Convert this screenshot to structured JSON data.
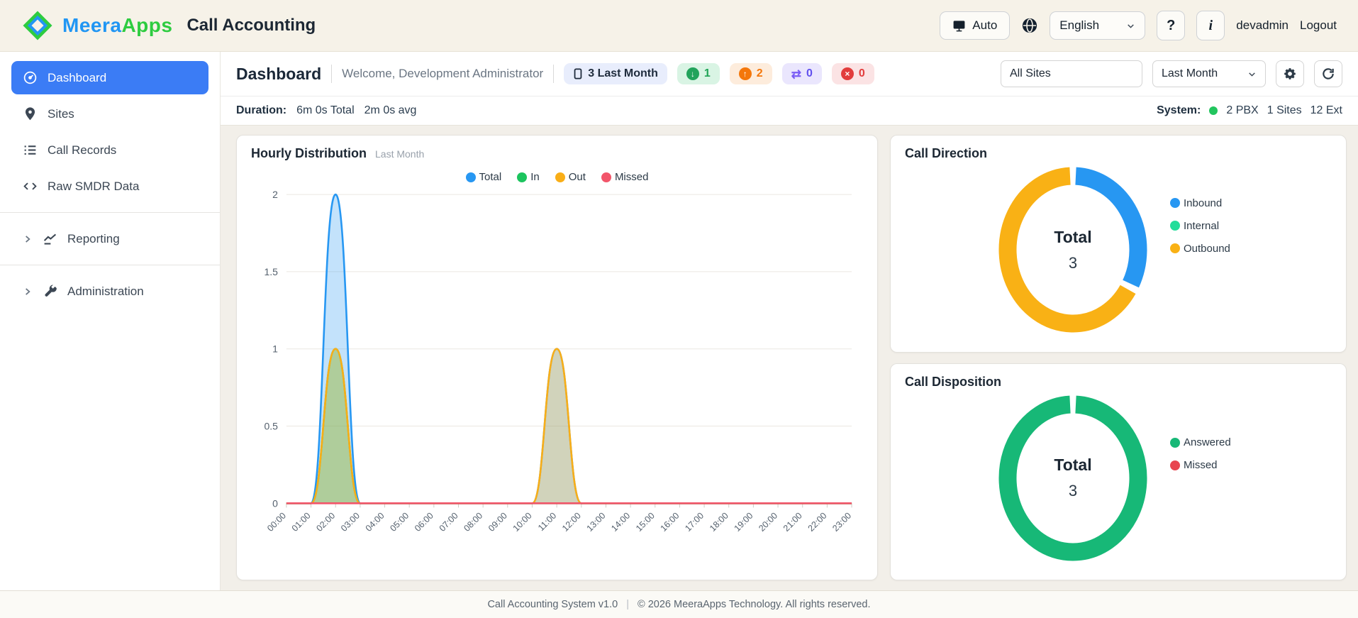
{
  "header": {
    "brand_meera": "Meera",
    "brand_apps": "Apps",
    "app_title": "Call Accounting",
    "auto_label": "Auto",
    "language": "English",
    "help_label": "?",
    "info_label": "i",
    "username": "devadmin",
    "logout_label": "Logout"
  },
  "sidebar": {
    "items": [
      {
        "label": "Dashboard",
        "icon": "speedometer-icon",
        "active": true
      },
      {
        "label": "Sites",
        "icon": "location-pin-icon",
        "active": false
      },
      {
        "label": "Call Records",
        "icon": "list-icon",
        "active": false
      },
      {
        "label": "Raw SMDR Data",
        "icon": "code-icon",
        "active": false
      },
      {
        "label": "Reporting",
        "icon": "trend-chart-icon",
        "active": false,
        "expandable": true
      },
      {
        "label": "Administration",
        "icon": "wrench-icon",
        "active": false,
        "expandable": true
      }
    ]
  },
  "page_header": {
    "title": "Dashboard",
    "welcome": "Welcome, Development Administrator",
    "period_badge": "3 Last Month",
    "inbound_count": "1",
    "outbound_count": "2",
    "internal_count": "0",
    "missed_count": "0",
    "site_filter": "All Sites",
    "period_filter": "Last Month"
  },
  "stats_bar": {
    "duration_label": "Duration:",
    "duration_total": "6m 0s Total",
    "duration_avg": "2m 0s avg",
    "system_label": "System:",
    "pbx": "2 PBX",
    "sites": "1 Sites",
    "ext": "12 Ext"
  },
  "chart_data": [
    {
      "type": "area",
      "title": "Hourly Distribution",
      "subtitle": "Last Month",
      "x": [
        "00:00",
        "01:00",
        "02:00",
        "03:00",
        "04:00",
        "05:00",
        "06:00",
        "07:00",
        "08:00",
        "09:00",
        "10:00",
        "11:00",
        "12:00",
        "13:00",
        "14:00",
        "15:00",
        "16:00",
        "17:00",
        "18:00",
        "19:00",
        "20:00",
        "21:00",
        "22:00",
        "23:00"
      ],
      "series": [
        {
          "name": "Total",
          "color": "#2797f2",
          "values": [
            0,
            0,
            2,
            0,
            0,
            0,
            0,
            0,
            0,
            0,
            0,
            1,
            0,
            0,
            0,
            0,
            0,
            0,
            0,
            0,
            0,
            0,
            0,
            0
          ]
        },
        {
          "name": "In",
          "color": "#1cc45e",
          "values": [
            0,
            0,
            1,
            0,
            0,
            0,
            0,
            0,
            0,
            0,
            0,
            0,
            0,
            0,
            0,
            0,
            0,
            0,
            0,
            0,
            0,
            0,
            0,
            0
          ]
        },
        {
          "name": "Out",
          "color": "#f9ae17",
          "values": [
            0,
            0,
            1,
            0,
            0,
            0,
            0,
            0,
            0,
            0,
            0,
            1,
            0,
            0,
            0,
            0,
            0,
            0,
            0,
            0,
            0,
            0,
            0,
            0
          ]
        },
        {
          "name": "Missed",
          "color": "#f2556a",
          "values": [
            0,
            0,
            0,
            0,
            0,
            0,
            0,
            0,
            0,
            0,
            0,
            0,
            0,
            0,
            0,
            0,
            0,
            0,
            0,
            0,
            0,
            0,
            0,
            0
          ]
        }
      ],
      "ylim": [
        0,
        2
      ],
      "yticks": [
        0,
        0.5,
        1,
        1.5,
        2
      ],
      "legend_position": "top",
      "grid": true
    },
    {
      "type": "pie",
      "title": "Call Direction",
      "center_label": "Total",
      "center_value": 3,
      "segments": [
        {
          "label": "Inbound",
          "value": 1,
          "color": "#2797f2"
        },
        {
          "label": "Internal",
          "value": 0,
          "color": "#23dd9a"
        },
        {
          "label": "Outbound",
          "value": 2,
          "color": "#f9b115"
        }
      ]
    },
    {
      "type": "pie",
      "title": "Call Disposition",
      "center_label": "Total",
      "center_value": 3,
      "segments": [
        {
          "label": "Answered",
          "value": 3,
          "color": "#17b877"
        },
        {
          "label": "Missed",
          "value": 0,
          "color": "#e8454f"
        }
      ]
    }
  ],
  "footer": {
    "text_left": "Call Accounting System v1.0",
    "separator": "|",
    "text_right": "© 2026 MeeraApps Technology. All rights reserved."
  }
}
